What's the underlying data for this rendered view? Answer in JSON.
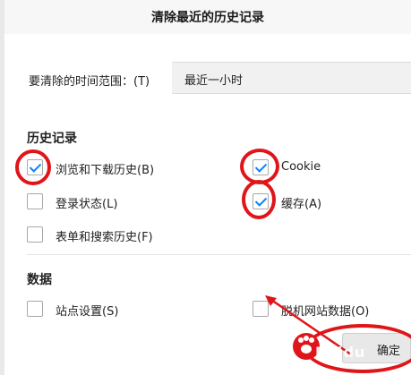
{
  "dialog": {
    "title": "清除最近的历史记录",
    "time_range_label": "要清除的时间范围：(T)",
    "time_range_value": "最近一小时"
  },
  "history": {
    "heading": "历史记录",
    "items": [
      {
        "label": "浏览和下载历史(B)",
        "checked": true
      },
      {
        "label": "Cookie",
        "checked": true
      },
      {
        "label": "登录状态(L)",
        "checked": false
      },
      {
        "label": "缓存(A)",
        "checked": true
      },
      {
        "label": "表单和搜索历史(F)",
        "checked": false
      }
    ]
  },
  "data": {
    "heading": "数据",
    "items": [
      {
        "label": "站点设置(S)",
        "checked": false
      },
      {
        "label": "脱机网站数据(O)",
        "checked": false
      }
    ]
  },
  "footer": {
    "ok_label": "确定"
  },
  "colors": {
    "check": "#0a84ff",
    "annotation": "#e0151a"
  },
  "watermark": {
    "text": "Baidu"
  }
}
